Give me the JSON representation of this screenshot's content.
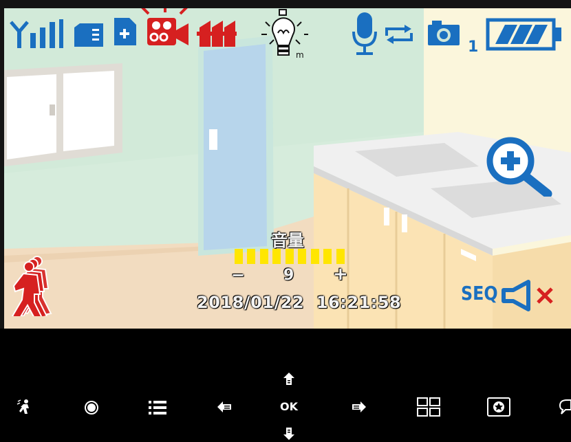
{
  "status_bar": {
    "icons": [
      "signal-icon",
      "sd-card-icon",
      "new-file-icon",
      "recording-icon",
      "motion-mask-icon",
      "night-light-icon",
      "microphone-icon",
      "loop-icon",
      "snapshot-icon",
      "battery-icon"
    ],
    "snapshot_count": "1"
  },
  "overlay": {
    "volume_label": "音量",
    "volume_minus": "−",
    "volume_value": "9",
    "volume_plus": "+",
    "volume_level": 9,
    "volume_max": 9,
    "timestamp": "2018/01/22  16:21:58",
    "seq_label": "SEQ"
  },
  "controls": {
    "ok_label": "OK",
    "buttons": [
      "motion-detect",
      "record",
      "menu",
      "left",
      "up",
      "ok",
      "down",
      "right",
      "layout",
      "snapshot",
      "talk"
    ]
  },
  "colors": {
    "accent_blue": "#1a6fc0",
    "alert_red": "#d62020",
    "volume_yellow": "#ffe600"
  }
}
